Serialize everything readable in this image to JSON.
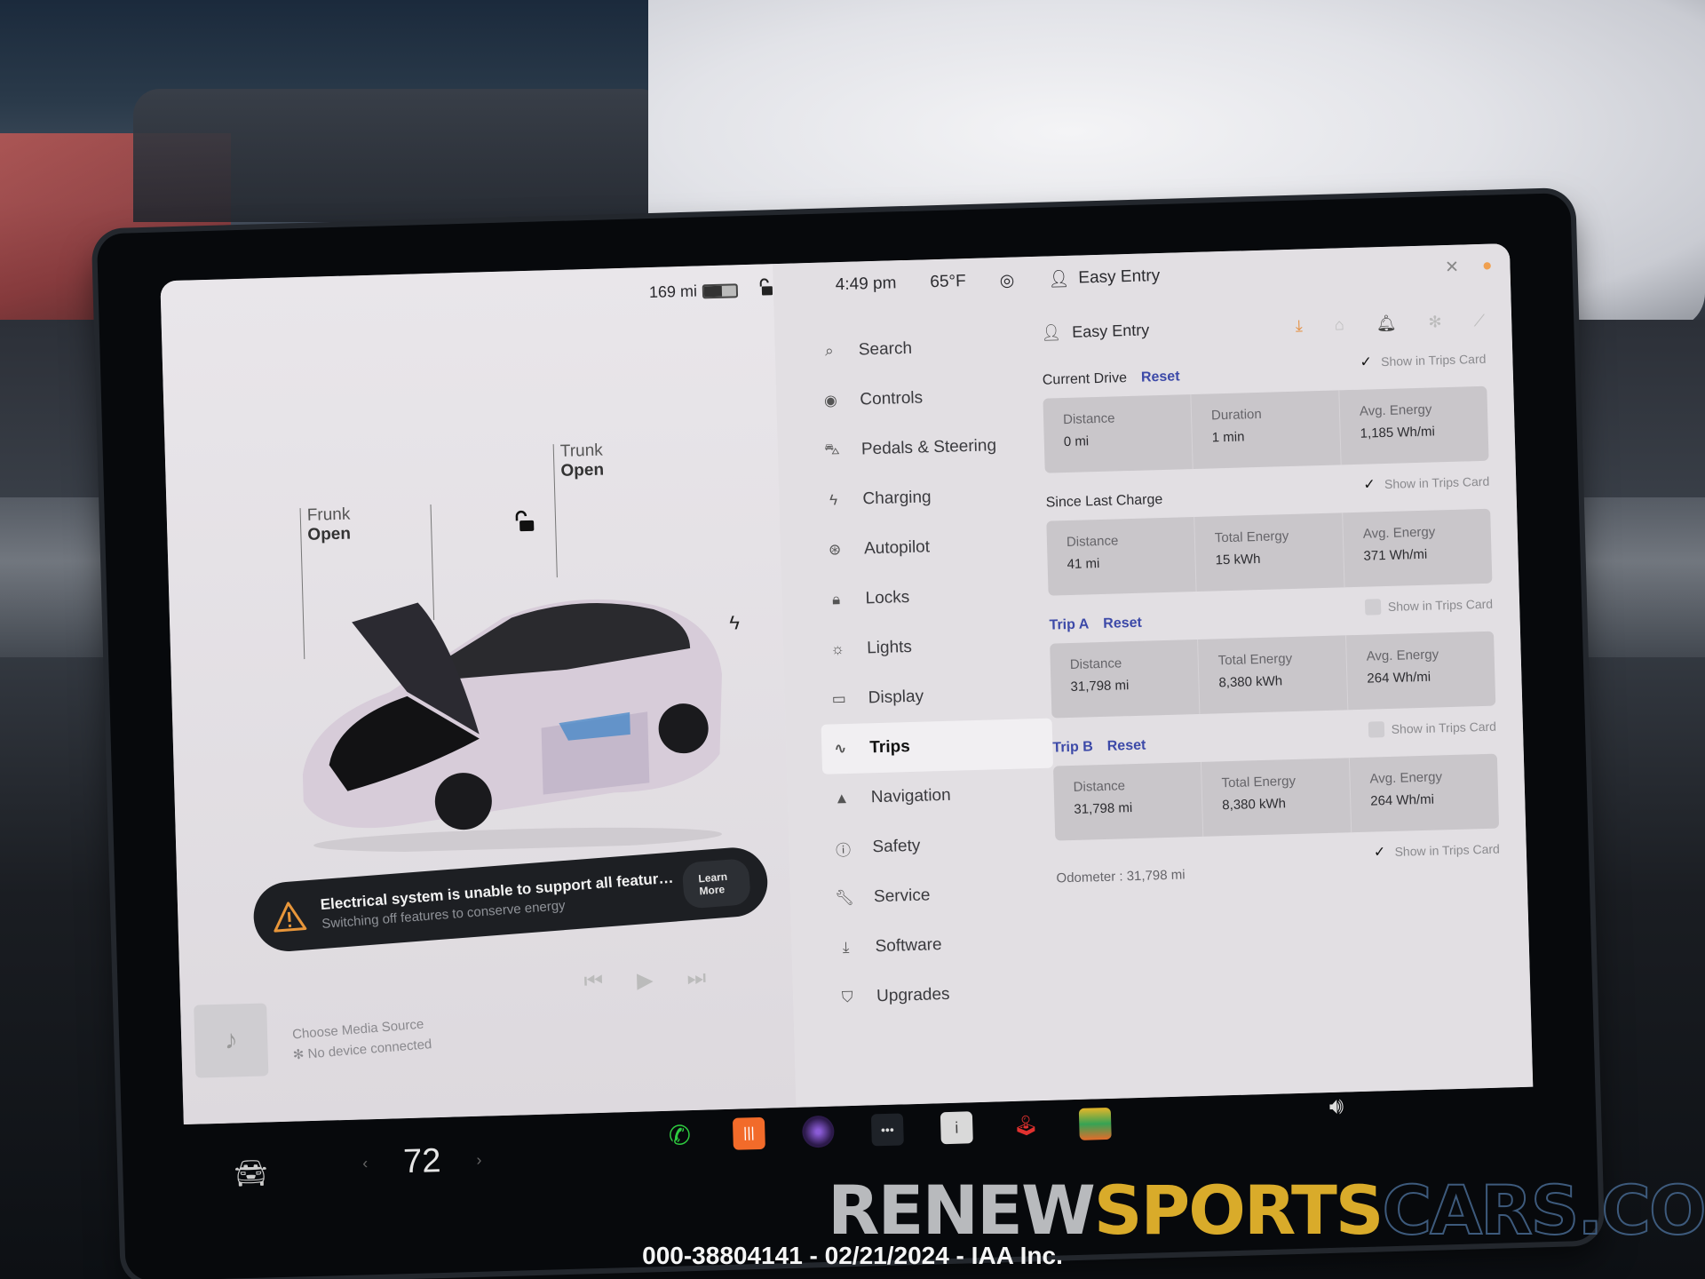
{
  "status_bar": {
    "range": "169 mi",
    "battery_level_percent": 55,
    "time": "4:49 pm",
    "temperature": "65°F",
    "profile": "Easy Entry"
  },
  "car_panel": {
    "frunk_label": "Frunk",
    "frunk_state": "Open",
    "trunk_label": "Trunk",
    "trunk_state": "Open",
    "lock_state": "unlocked"
  },
  "alert": {
    "title": "Electrical system is unable to support all featur…",
    "subtitle": "Switching off features to conserve energy",
    "action_label": "Learn More",
    "icon": "warning-triangle-icon",
    "icon_color": "#e8963a"
  },
  "media": {
    "title": "Choose Media Source",
    "subtitle": "No device connected"
  },
  "menu": {
    "items": [
      {
        "label": "Search",
        "icon": "search-icon",
        "glyph": "⌕"
      },
      {
        "label": "Controls",
        "icon": "toggle-icon",
        "glyph": "◉"
      },
      {
        "label": "Pedals & Steering",
        "icon": "car-icon",
        "glyph": "⛍"
      },
      {
        "label": "Charging",
        "icon": "bolt-icon",
        "glyph": "ϟ"
      },
      {
        "label": "Autopilot",
        "icon": "steering-wheel-icon",
        "glyph": "⊛"
      },
      {
        "label": "Locks",
        "icon": "lock-icon",
        "glyph": "🔒︎"
      },
      {
        "label": "Lights",
        "icon": "sun-icon",
        "glyph": "☼"
      },
      {
        "label": "Display",
        "icon": "display-icon",
        "glyph": "▭"
      },
      {
        "label": "Trips",
        "icon": "trips-icon",
        "glyph": "∿",
        "active": true
      },
      {
        "label": "Navigation",
        "icon": "navigation-arrow-icon",
        "glyph": "▲"
      },
      {
        "label": "Safety",
        "icon": "safety-icon",
        "glyph": "ⓘ"
      },
      {
        "label": "Service",
        "icon": "wrench-icon",
        "glyph": "🔧︎"
      },
      {
        "label": "Software",
        "icon": "download-icon",
        "glyph": "⤓"
      },
      {
        "label": "Upgrades",
        "icon": "bag-icon",
        "glyph": "⛉"
      }
    ]
  },
  "content": {
    "profile": "Easy Entry",
    "show_in_trips_label": "Show in Trips Card",
    "reset_label": "Reset",
    "current_drive": {
      "title": "Current Drive",
      "show_in_trips": true,
      "stats": [
        {
          "label": "Distance",
          "value": "0 mi"
        },
        {
          "label": "Duration",
          "value": "1 min"
        },
        {
          "label": "Avg. Energy",
          "value": "1,185 Wh/mi"
        }
      ]
    },
    "since_last_charge": {
      "title": "Since Last Charge",
      "show_in_trips": true,
      "stats": [
        {
          "label": "Distance",
          "value": "41 mi"
        },
        {
          "label": "Total Energy",
          "value": "15 kWh"
        },
        {
          "label": "Avg. Energy",
          "value": "371 Wh/mi"
        }
      ]
    },
    "trip_a": {
      "title": "Trip A",
      "show_in_trips": false,
      "stats": [
        {
          "label": "Distance",
          "value": "31,798 mi"
        },
        {
          "label": "Total Energy",
          "value": "8,380 kWh"
        },
        {
          "label": "Avg. Energy",
          "value": "264 Wh/mi"
        }
      ]
    },
    "trip_b": {
      "title": "Trip B",
      "show_in_trips": false,
      "stats": [
        {
          "label": "Distance",
          "value": "31,798 mi"
        },
        {
          "label": "Total Energy",
          "value": "8,380 kWh"
        },
        {
          "label": "Avg. Energy",
          "value": "264 Wh/mi"
        }
      ]
    },
    "odometer": {
      "label": "Odometer",
      "value": "31,798 mi",
      "show_in_trips": true
    }
  },
  "dock": {
    "cabin_temp": "72",
    "apps": [
      "phone-app",
      "audio-app",
      "camera-app",
      "more-apps",
      "owners-manual-app",
      "arcade-app",
      "toybox-app"
    ]
  },
  "watermark": {
    "brand_part1": "RENEW",
    "brand_part2": "SPORTS",
    "brand_part3": "CARS.COM",
    "caption": "000-38804141 - 02/21/2024 - IAA Inc."
  }
}
